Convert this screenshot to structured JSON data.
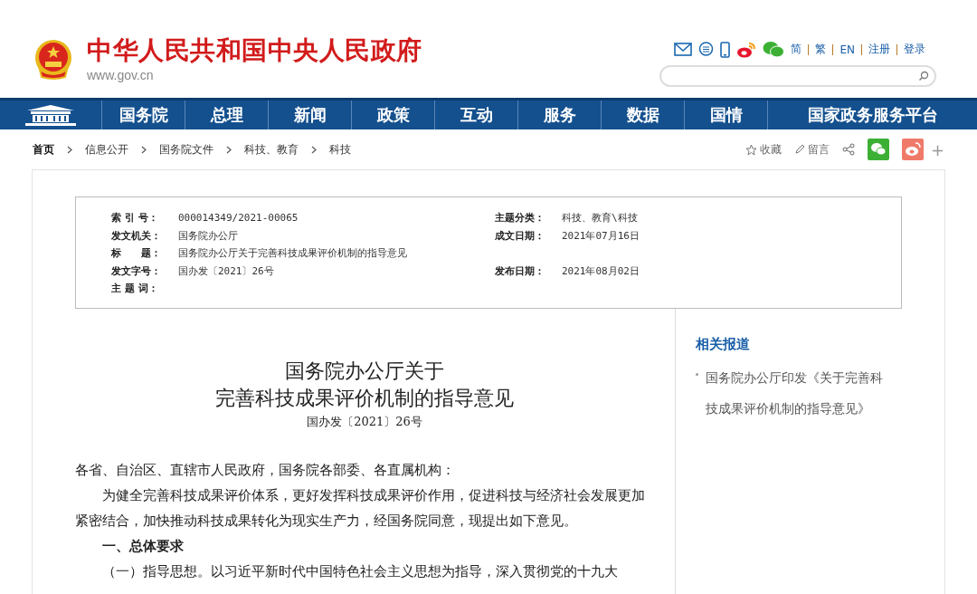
{
  "header": {
    "site_title": "中华人民共和国中央人民政府",
    "site_url": "www.gov.cn",
    "links": [
      "简",
      "繁",
      "EN",
      "注册",
      "登录"
    ]
  },
  "nav": {
    "items": [
      "国务院",
      "总理",
      "新闻",
      "政策",
      "互动",
      "服务",
      "数据",
      "国情",
      "国家政务服务平台"
    ]
  },
  "breadcrumb": [
    "首页",
    "信息公开",
    "国务院文件",
    "科技、教育",
    "科技"
  ],
  "toolbar": {
    "favorite": "收藏",
    "comment": "留言",
    "plus": "+"
  },
  "meta": [
    {
      "label": "索 引 号：",
      "value": "000014349/2021-00065",
      "label2": "主题分类：",
      "value2": "科技、教育\\科技"
    },
    {
      "label": "发文机关：",
      "value": "国务院办公厅",
      "label2": "成文日期：",
      "value2": "2021年07月16日"
    },
    {
      "label": "标　　题：",
      "value": "国务院办公厅关于完善科技成果评价机制的指导意见"
    },
    {
      "label": "发文字号：",
      "value": "国办发〔2021〕26号",
      "label2": "发布日期：",
      "value2": "2021年08月02日"
    },
    {
      "label": "主 题 词："
    }
  ],
  "article": {
    "title_lines": [
      "国务院办公厅关于",
      "完善科技成果评价机制的指导意见"
    ],
    "doc_number": "国办发〔2021〕26号",
    "paragraphs": [
      {
        "kind": "salutation",
        "text": "各省、自治区、直辖市人民政府，国务院各部委、各直属机构："
      },
      {
        "kind": "body",
        "text": "为健全完善科技成果评价体系，更好发挥科技成果评价作用，促进科技与经济社会发展更加紧密结合，加快推动科技成果转化为现实生产力，经国务院同意，现提出如下意见。"
      },
      {
        "kind": "heading",
        "text": "一、总体要求"
      },
      {
        "kind": "body",
        "text": "（一）指导思想。以习近平新时代中国特色社会主义思想为指导，深入贯彻党的十九大"
      }
    ]
  },
  "sidebar": {
    "title": "相关报道",
    "items": [
      "国务院办公厅印发《关于完善科技成果评价机制的指导意见》"
    ]
  }
}
